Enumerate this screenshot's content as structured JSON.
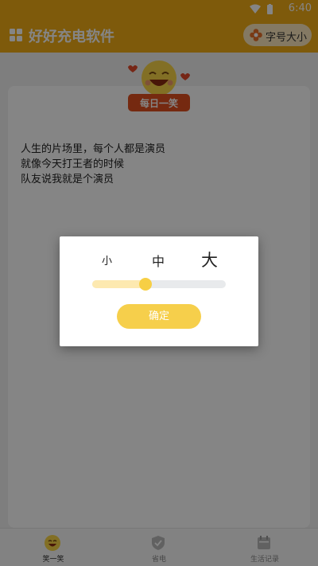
{
  "status": {
    "time": "6:40"
  },
  "appbar": {
    "title": "好好充电软件",
    "font_size_button": "字号大小"
  },
  "badge": {
    "label": "每日一笑"
  },
  "joke": {
    "line1": "人生的片场里，每个人都是演员",
    "line2": "就像今天打王者的时候",
    "line3": "队友说我就是个演员"
  },
  "dialog": {
    "options": {
      "small": "小",
      "medium": "中",
      "large": "大"
    },
    "selected": "中",
    "slider_value": 0.4,
    "confirm": "确定"
  },
  "tabs": [
    {
      "label": "笑一笑",
      "icon": "smile-icon",
      "active": true
    },
    {
      "label": "省电",
      "icon": "shield-check-icon",
      "active": false
    },
    {
      "label": "生活记录",
      "icon": "calendar-icon",
      "active": false
    }
  ],
  "colors": {
    "brand": "#f2ad16",
    "accent": "#f6cf4b",
    "badge_red": "#e0501f"
  }
}
